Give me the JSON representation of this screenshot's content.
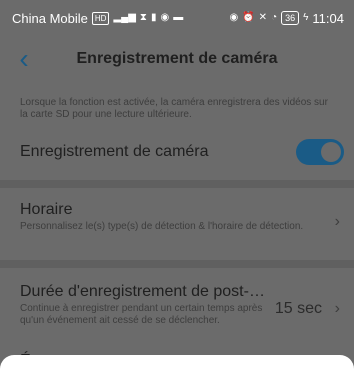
{
  "status_bar": {
    "carrier": "China Mobile",
    "hd_badge": "HD",
    "signal": "4G",
    "battery": "36",
    "time": "11:04"
  },
  "header": {
    "back_icon": "chevron-left-icon",
    "title": "Enregistrement de caméra"
  },
  "description": "Lorsque la fonction est activée, la caméra enregistrera des vidéos sur la carte SD pour une lecture ultérieure.",
  "record_toggle": {
    "label": "Enregistrement de caméra",
    "enabled": true
  },
  "schedule": {
    "title": "Horaire",
    "subtitle": "Personnalisez le(s) type(s) de détection & l'horaire de détection."
  },
  "post_duration": {
    "title": "Durée d'enregistrement de post-…",
    "subtitle": "Continue à enregistrer pendant un certain temps après qu'un événement ait cessé de se déclencher.",
    "value": "15 sec"
  },
  "peek_item": {
    "title": "É"
  },
  "colors": {
    "accent": "#1a5b86",
    "overlay": "#6b6b6b"
  }
}
